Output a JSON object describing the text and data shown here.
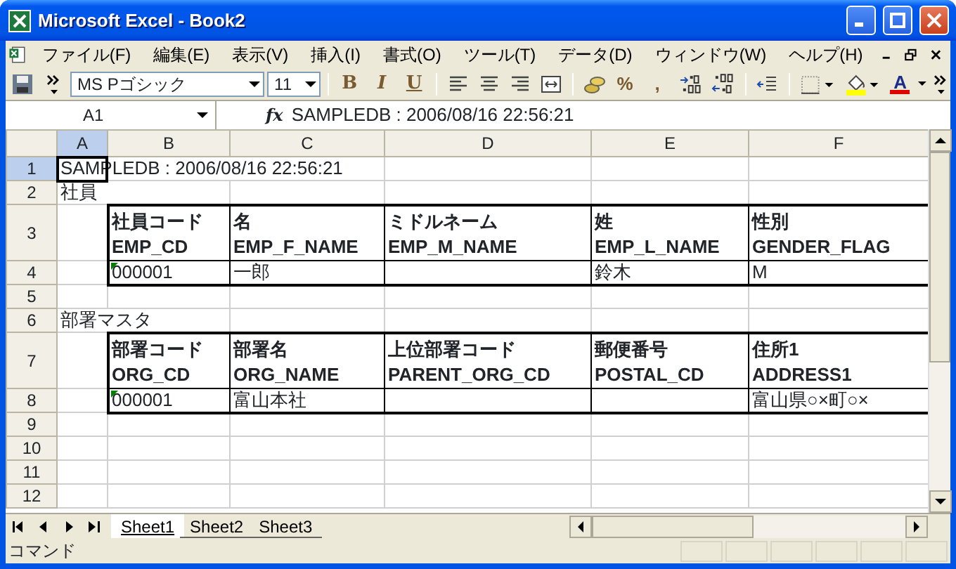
{
  "window": {
    "title": "Microsoft Excel - Book2"
  },
  "menu": [
    "ファイル(F)",
    "編集(E)",
    "表示(V)",
    "挿入(I)",
    "書式(O)",
    "ツール(T)",
    "データ(D)",
    "ウィンドウ(W)",
    "ヘルプ(H)"
  ],
  "toolbar": {
    "font": "MS Pゴシック",
    "size": "11",
    "style_buttons": [
      "B",
      "I",
      "U"
    ],
    "number_buttons": [
      "%",
      ","
    ],
    "font_color_button": "A"
  },
  "formula_bar": {
    "name_box": "A1",
    "function_label": "fx",
    "value": "SAMPLEDB : 2006/08/16 22:56:21"
  },
  "columns": [
    {
      "label": "A",
      "selected": true
    },
    {
      "label": "B",
      "selected": false
    },
    {
      "label": "C",
      "selected": false
    },
    {
      "label": "D",
      "selected": false
    },
    {
      "label": "E",
      "selected": false
    },
    {
      "label": "F",
      "selected": false
    }
  ],
  "rows": [
    {
      "number": "1",
      "selected": true,
      "kind": "caption",
      "text": "SAMPLEDB : 2006/08/16 22:56:21",
      "active": true
    },
    {
      "number": "2",
      "selected": false,
      "kind": "caption",
      "text": "社員"
    },
    {
      "number": "3",
      "selected": false,
      "kind": "header",
      "cells": [
        {
          "ja": "社員コード",
          "en": "EMP_CD"
        },
        {
          "ja": "名",
          "en": "EMP_F_NAME"
        },
        {
          "ja": "ミドルネーム",
          "en": "EMP_M_NAME"
        },
        {
          "ja": "姓",
          "en": "EMP_L_NAME"
        },
        {
          "ja": "性別",
          "en": "GENDER_FLAG"
        }
      ]
    },
    {
      "number": "4",
      "selected": false,
      "kind": "data",
      "cells": [
        {
          "text": "000001",
          "warning": true
        },
        {
          "text": "一郎",
          "warning": false
        },
        null,
        {
          "text": "鈴木",
          "warning": false
        },
        {
          "text": "M",
          "warning": false
        }
      ]
    },
    {
      "number": "5",
      "selected": false,
      "kind": "empty"
    },
    {
      "number": "6",
      "selected": false,
      "kind": "caption",
      "text": "部署マスタ"
    },
    {
      "number": "7",
      "selected": false,
      "kind": "header",
      "cells": [
        {
          "ja": "部署コード",
          "en": "ORG_CD"
        },
        {
          "ja": "部署名",
          "en": "ORG_NAME"
        },
        {
          "ja": "上位部署コード",
          "en": "PARENT_ORG_CD"
        },
        {
          "ja": "郵便番号",
          "en": "POSTAL_CD"
        },
        {
          "ja": "住所1",
          "en": "ADDRESS1"
        }
      ]
    },
    {
      "number": "8",
      "selected": false,
      "kind": "data",
      "cells": [
        {
          "text": "000001",
          "warning": true
        },
        {
          "text": "富山本社",
          "warning": false
        },
        null,
        null,
        {
          "text": "富山県○×町○×",
          "warning": false
        }
      ]
    },
    {
      "number": "9",
      "selected": false,
      "kind": "empty"
    },
    {
      "number": "10",
      "selected": false,
      "kind": "empty"
    },
    {
      "number": "11",
      "selected": false,
      "kind": "empty"
    },
    {
      "number": "12",
      "selected": false,
      "kind": "empty"
    }
  ],
  "sheet_tabs": [
    {
      "label": "Sheet1",
      "selected": true
    },
    {
      "label": "Sheet2",
      "selected": false
    },
    {
      "label": "Sheet3",
      "selected": false
    }
  ],
  "status_bar": {
    "text": "コマンド"
  }
}
